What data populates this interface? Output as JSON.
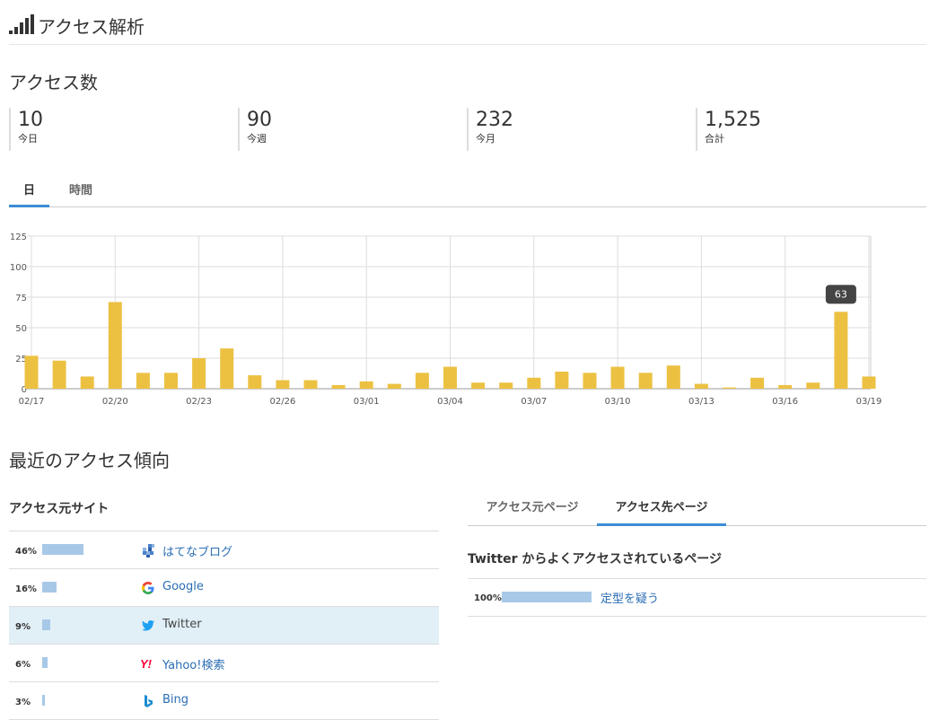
{
  "header": {
    "title": "アクセス解析",
    "icon": "signal-bars-icon"
  },
  "access_count": {
    "title": "アクセス数",
    "stats": [
      {
        "value": "10",
        "label": "今日"
      },
      {
        "value": "90",
        "label": "今週"
      },
      {
        "value": "232",
        "label": "今月"
      },
      {
        "value": "1,525",
        "label": "合計"
      }
    ]
  },
  "chart_tabs": [
    {
      "label": "日",
      "active": true
    },
    {
      "label": "時間",
      "active": false
    }
  ],
  "chart_data": {
    "type": "bar",
    "categories": [
      "02/17",
      "02/18",
      "02/19",
      "02/20",
      "02/21",
      "02/22",
      "02/23",
      "02/24",
      "02/25",
      "02/26",
      "02/27",
      "02/28",
      "03/01",
      "03/02",
      "03/03",
      "03/04",
      "03/05",
      "03/06",
      "03/07",
      "03/08",
      "03/09",
      "03/10",
      "03/11",
      "03/12",
      "03/13",
      "03/14",
      "03/15",
      "03/16",
      "03/17",
      "03/18",
      "03/19"
    ],
    "values": [
      27,
      23,
      10,
      71,
      13,
      13,
      25,
      33,
      11,
      7,
      7,
      3,
      6,
      4,
      13,
      18,
      5,
      5,
      9,
      14,
      13,
      18,
      13,
      19,
      4,
      1,
      9,
      3,
      5,
      63,
      10
    ],
    "x_tick_labels": [
      "02/17",
      "02/20",
      "02/23",
      "02/26",
      "03/01",
      "03/04",
      "03/07",
      "03/10",
      "03/13",
      "03/16",
      "03/19"
    ],
    "y_ticks": [
      0,
      25,
      50,
      75,
      100,
      125
    ],
    "ylim": [
      0,
      125
    ],
    "grid": true,
    "bar_color": "#ecc142",
    "tooltip": {
      "category": "03/18",
      "value": "63"
    }
  },
  "trend": {
    "title": "最近のアクセス傾向",
    "sources_title": "アクセス元サイト",
    "sources": [
      {
        "percent_label": "46%",
        "percent": 46,
        "name": "はてなブログ",
        "icon": "hatena-blog-icon",
        "link": true,
        "highlighted": false
      },
      {
        "percent_label": "16%",
        "percent": 16,
        "name": "Google",
        "icon": "google-icon",
        "link": true,
        "highlighted": false
      },
      {
        "percent_label": "9%",
        "percent": 9,
        "name": "Twitter",
        "icon": "twitter-icon",
        "link": false,
        "highlighted": true
      },
      {
        "percent_label": "6%",
        "percent": 6,
        "name": "Yahoo!検索",
        "icon": "yahoo-icon",
        "link": true,
        "highlighted": false
      },
      {
        "percent_label": "3%",
        "percent": 3,
        "name": "Bing",
        "icon": "bing-icon",
        "link": true,
        "highlighted": false
      }
    ],
    "page_tabs": [
      {
        "label": "アクセス元ページ",
        "active": false
      },
      {
        "label": "アクセス先ページ",
        "active": true
      }
    ],
    "dest_title": "Twitter からよくアクセスされているページ",
    "dest_pages": [
      {
        "percent_label": "100%",
        "percent": 100,
        "name": "定型を疑う"
      }
    ]
  },
  "colors": {
    "accent": "#3c8dd6",
    "bar": "#ecc142",
    "link": "#2a6db3",
    "share_bar": "#a8c8e8",
    "highlight": "#e1eff7"
  }
}
